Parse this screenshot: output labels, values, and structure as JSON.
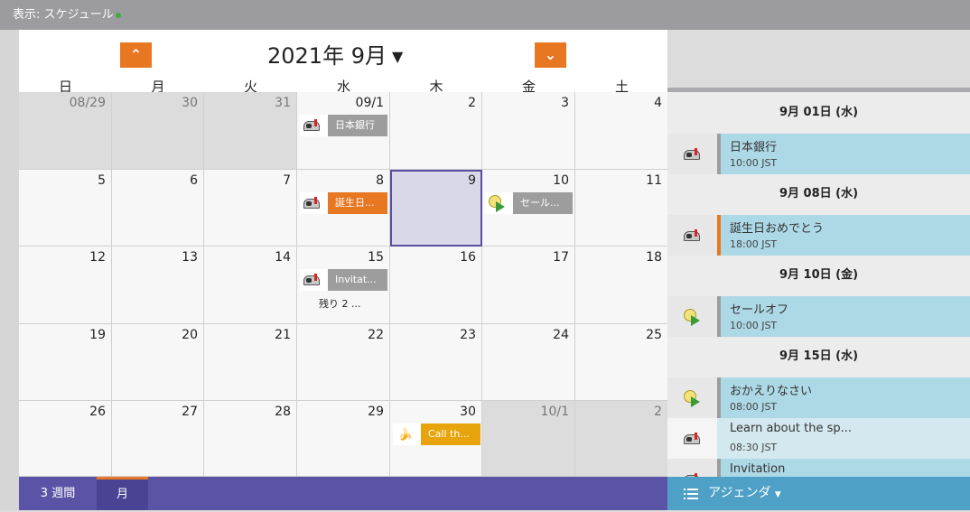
{
  "topbar": {
    "label": "表示: スケジュール"
  },
  "calendar": {
    "title": "2021年 9月",
    "weekdays": [
      "日",
      "月",
      "火",
      "水",
      "木",
      "金",
      "土"
    ],
    "weeks": [
      [
        {
          "d": "08/29",
          "other": true
        },
        {
          "d": "30",
          "other": true
        },
        {
          "d": "31",
          "other": true
        },
        {
          "d": "09/1",
          "event": {
            "icon": "mailbox",
            "label": "日本銀行",
            "color": "#9d9d9d"
          }
        },
        {
          "d": "2"
        },
        {
          "d": "3"
        },
        {
          "d": "4"
        }
      ],
      [
        {
          "d": "5"
        },
        {
          "d": "6"
        },
        {
          "d": "7"
        },
        {
          "d": "8",
          "event": {
            "icon": "mailbox",
            "label": "誕生日...",
            "color": "#e87722"
          }
        },
        {
          "d": "9",
          "today": true
        },
        {
          "d": "10",
          "event": {
            "icon": "bulb",
            "label": "セール...",
            "color": "#9d9d9d"
          }
        },
        {
          "d": "11"
        }
      ],
      [
        {
          "d": "12"
        },
        {
          "d": "13"
        },
        {
          "d": "14"
        },
        {
          "d": "15",
          "event": {
            "icon": "mailbox",
            "label": "Invitat...",
            "color": "#9d9d9d"
          },
          "more": "残り 2 ..."
        },
        {
          "d": "16"
        },
        {
          "d": "17"
        },
        {
          "d": "18"
        }
      ],
      [
        {
          "d": "19"
        },
        {
          "d": "20"
        },
        {
          "d": "21"
        },
        {
          "d": "22"
        },
        {
          "d": "23"
        },
        {
          "d": "24"
        },
        {
          "d": "25"
        }
      ],
      [
        {
          "d": "26"
        },
        {
          "d": "27"
        },
        {
          "d": "28"
        },
        {
          "d": "29"
        },
        {
          "d": "30",
          "event": {
            "icon": "banana",
            "label": "Call th...",
            "color": "#e8a40c"
          }
        },
        {
          "d": "10/1",
          "other": true
        },
        {
          "d": "2",
          "other": true
        }
      ]
    ]
  },
  "agenda": {
    "groups": [
      {
        "header": "9月 01日 (水)",
        "items": [
          {
            "icon": "mailbox",
            "title": "日本銀行",
            "time": "10:00 JST",
            "bar": "#9d9d9d",
            "bg": "#add8e6"
          }
        ]
      },
      {
        "header": "9月 08日 (水)",
        "items": [
          {
            "icon": "mailbox",
            "title": "誕生日おめでとう",
            "time": "18:00 JST",
            "bar": "#e87722",
            "bg": "#add8e6"
          }
        ]
      },
      {
        "header": "9月 10日 (金)",
        "items": [
          {
            "icon": "bulb",
            "title": "セールオフ",
            "time": "10:00 JST",
            "bar": "#9d9d9d",
            "bg": "#add8e6"
          }
        ]
      },
      {
        "header": "9月 15日 (水)",
        "items": [
          {
            "icon": "bulb",
            "title": "おかえりなさい",
            "time": "08:00 JST",
            "bar": "#9d9d9d",
            "bg": "#add8e6"
          },
          {
            "icon": "mailbox",
            "title": "Learn about the sp...",
            "time": "08:30 JST",
            "bar": "#d4e9ef",
            "bg": "#d4e9ef"
          },
          {
            "icon": "mailbox",
            "title": "Invitation",
            "time": "",
            "bar": "#9d9d9d",
            "bg": "#add8e6"
          }
        ]
      }
    ]
  },
  "bottom": {
    "three_week": "3 週間",
    "month": "月",
    "agenda": "アジェンダ"
  },
  "colors": {
    "accent": "#e87722",
    "bottom_bar": "#5b54a6",
    "agenda_bar": "#4ea0c7"
  }
}
